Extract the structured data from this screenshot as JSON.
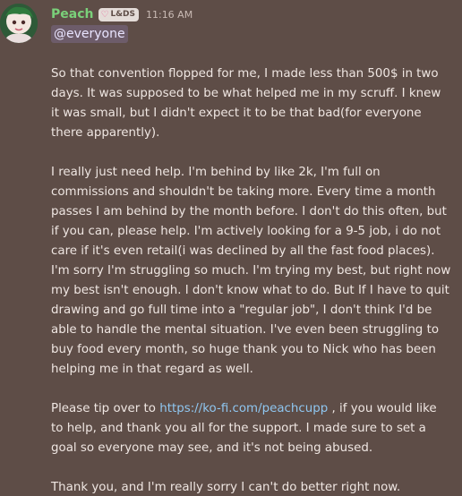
{
  "user": {
    "name": "Peach",
    "badge": "L&DS",
    "time": "11:16 AM",
    "avatar": "anime-avatar-icon"
  },
  "mention": "@everyone",
  "paragraphs": [
    "So that convention flopped for me, I made less than 500$ in two days. It was supposed to be what helped me in my scruff. I knew it was small, but I didn't expect it to be that bad(for everyone there apparently).",
    "I really just need help. I'm behind by like 2k, I'm full on commissions and shouldn't be taking more. Every time a month passes I am behind by the month before. I don't do this often, but if you can, please help. I'm actively looking for a 9-5 job, i do not care if it's even retail(i was declined by all the fast food places). I'm sorry I'm struggling so much. I'm trying my best, but right now my best isn't enough. I don't know what to do. But If I have to quit drawing and go full time into a \"regular job\", I don't think I'd be able to handle the mental situation. I've even been struggling to buy food every month, so huge thank you to Nick who has been helping me in that regard as well.",
    "",
    "Thank you, and I'm really sorry I can't do better right now."
  ],
  "tip": {
    "before": "Please tip over to ",
    "link": "https://ko-fi.com/peachcupp",
    "after": " , if you would like to help, and thank you all for the support. I made sure to set a goal so everyone may see, and it's not being abused."
  },
  "colors": {
    "background": "#5e4d47",
    "username": "#7ad07a",
    "link": "#8fc6f0",
    "mention_bg": "#6d5c6a"
  }
}
